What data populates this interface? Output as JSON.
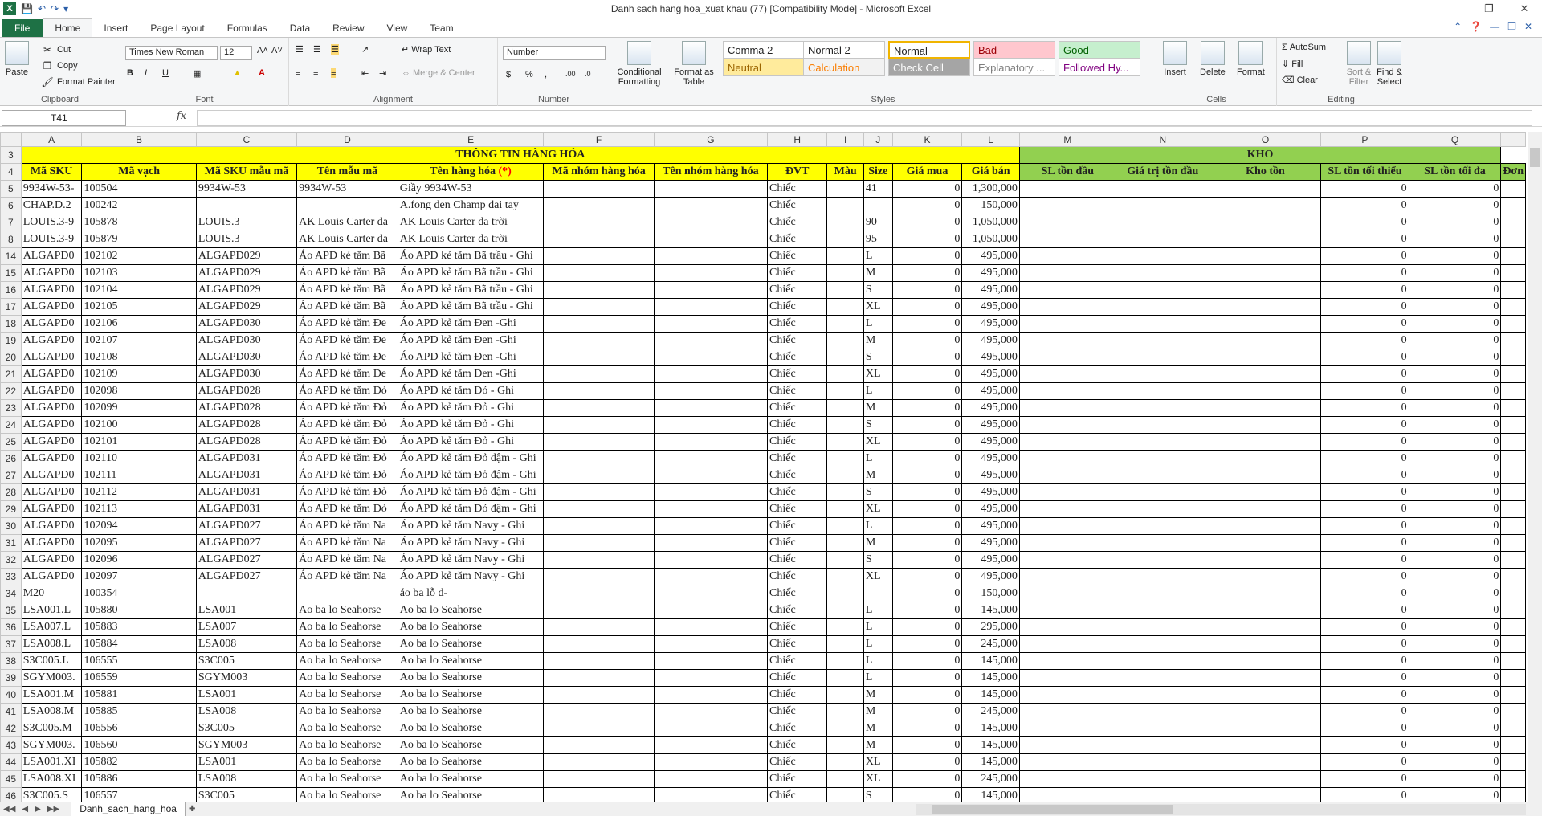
{
  "window": {
    "title": "Danh sach hang hoa_xuat khau (77)  [Compatibility Mode]  -  Microsoft Excel"
  },
  "tabs": [
    "File",
    "Home",
    "Insert",
    "Page Layout",
    "Formulas",
    "Data",
    "Review",
    "View",
    "Team"
  ],
  "ribbon": {
    "clipboard": {
      "label": "Clipboard",
      "paste": "Paste",
      "cut": "Cut",
      "copy": "Copy",
      "format_painter": "Format Painter"
    },
    "font": {
      "label": "Font",
      "name": "Times New Roman",
      "size": "12"
    },
    "alignment": {
      "label": "Alignment",
      "wrap": "Wrap Text",
      "merge": "Merge & Center"
    },
    "number": {
      "label": "Number",
      "format": "Number"
    },
    "styles": {
      "label": "Styles",
      "conditional": "Conditional Formatting",
      "format_table": "Format as Table",
      "cells": [
        {
          "name": "Comma 2",
          "bg": "#ffffff",
          "fg": "#222222"
        },
        {
          "name": "Normal 2",
          "bg": "#ffffff",
          "fg": "#222222"
        },
        {
          "name": "Normal",
          "bg": "#ffffff",
          "fg": "#222222"
        },
        {
          "name": "Bad",
          "bg": "#ffc7ce",
          "fg": "#9c0006"
        },
        {
          "name": "Good",
          "bg": "#c6efce",
          "fg": "#006100"
        },
        {
          "name": "Neutral",
          "bg": "#ffeb9c",
          "fg": "#9c6500"
        },
        {
          "name": "Calculation",
          "bg": "#f2f2f2",
          "fg": "#fa7d00"
        },
        {
          "name": "Check Cell",
          "bg": "#a5a5a5",
          "fg": "#ffffff"
        },
        {
          "name": "Explanatory ...",
          "bg": "#ffffff",
          "fg": "#7f7f7f"
        },
        {
          "name": "Followed Hy...",
          "bg": "#ffffff",
          "fg": "#800080"
        }
      ]
    },
    "cells": {
      "label": "Cells",
      "insert": "Insert",
      "delete": "Delete",
      "format": "Format"
    },
    "editing": {
      "label": "Editing",
      "autosum": "AutoSum",
      "fill": "Fill",
      "clear": "Clear",
      "sort": "Sort & Filter",
      "find": "Find & Select"
    }
  },
  "formula_bar": {
    "name_box": "T41",
    "fx": "fx",
    "formula": ""
  },
  "sheet": {
    "columns": [
      "A",
      "B",
      "C",
      "D",
      "E",
      "F",
      "G",
      "H",
      "I",
      "J",
      "K",
      "L",
      "M",
      "N",
      "O",
      "P",
      "Q"
    ],
    "row3": {
      "num": "3",
      "info": "THÔNG TIN HÀNG HÓA",
      "kho": "KHO"
    },
    "headers": [
      "Mã SKU",
      "Mã vạch",
      "Mã SKU mẫu mã",
      "Tên mẫu mã",
      "Tên hàng hóa ",
      "Mã nhóm hàng hóa",
      "Tên nhóm hàng hóa",
      "ĐVT",
      "Màu",
      "Size",
      "Giá mua",
      "Giá bán",
      "SL tồn đầu",
      "Giá trị tồn đầu",
      "Kho tồn",
      "SL tồn tối thiểu",
      "SL tồn tối đa"
    ],
    "header_required": "(*)",
    "next_col_clip": "Đơn",
    "rows": [
      [
        "5",
        "9934W-53-",
        "100504",
        "9934W-53",
        "9934W-53",
        "Giầy 9934W-53",
        "",
        "",
        "Chiếc",
        "",
        "41",
        "0",
        "1,300,000",
        "",
        "",
        "",
        "0",
        "0"
      ],
      [
        "6",
        "CHAP.D.2",
        "100242",
        "",
        "",
        "A.fong den Champ dai tay",
        "",
        "",
        "Chiếc",
        "",
        "",
        "0",
        "150,000",
        "",
        "",
        "",
        "0",
        "0"
      ],
      [
        "7",
        "LOUIS.3-9",
        "105878",
        "LOUIS.3",
        "AK Louis Carter da",
        "AK Louis Carter da trời",
        "",
        "",
        "Chiếc",
        "",
        "90",
        "0",
        "1,050,000",
        "",
        "",
        "",
        "0",
        "0"
      ],
      [
        "8",
        "LOUIS.3-9",
        "105879",
        "LOUIS.3",
        "AK Louis Carter da",
        "AK Louis Carter da trời",
        "",
        "",
        "Chiếc",
        "",
        "95",
        "0",
        "1,050,000",
        "",
        "",
        "",
        "0",
        "0"
      ],
      [
        "14",
        "ALGAPD0",
        "102102",
        "ALGAPD029",
        "Áo APD kẻ tăm Bã",
        "Áo APD kẻ tăm Bã trầu - Ghi",
        "",
        "",
        "Chiếc",
        "",
        "L",
        "0",
        "495,000",
        "",
        "",
        "",
        "0",
        "0"
      ],
      [
        "15",
        "ALGAPD0",
        "102103",
        "ALGAPD029",
        "Áo APD kẻ tăm Bã",
        "Áo APD kẻ tăm Bã trầu - Ghi",
        "",
        "",
        "Chiếc",
        "",
        "M",
        "0",
        "495,000",
        "",
        "",
        "",
        "0",
        "0"
      ],
      [
        "16",
        "ALGAPD0",
        "102104",
        "ALGAPD029",
        "Áo APD kẻ tăm Bã",
        "Áo APD kẻ tăm Bã trầu - Ghi",
        "",
        "",
        "Chiếc",
        "",
        "S",
        "0",
        "495,000",
        "",
        "",
        "",
        "0",
        "0"
      ],
      [
        "17",
        "ALGAPD0",
        "102105",
        "ALGAPD029",
        "Áo APD kẻ tăm Bã",
        "Áo APD kẻ tăm Bã trầu - Ghi",
        "",
        "",
        "Chiếc",
        "",
        "XL",
        "0",
        "495,000",
        "",
        "",
        "",
        "0",
        "0"
      ],
      [
        "18",
        "ALGAPD0",
        "102106",
        "ALGAPD030",
        "Áo APD kẻ tăm Đe",
        "Áo APD kẻ tăm Đen -Ghi",
        "",
        "",
        "Chiếc",
        "",
        "L",
        "0",
        "495,000",
        "",
        "",
        "",
        "0",
        "0"
      ],
      [
        "19",
        "ALGAPD0",
        "102107",
        "ALGAPD030",
        "Áo APD kẻ tăm Đe",
        "Áo APD kẻ tăm Đen -Ghi",
        "",
        "",
        "Chiếc",
        "",
        "M",
        "0",
        "495,000",
        "",
        "",
        "",
        "0",
        "0"
      ],
      [
        "20",
        "ALGAPD0",
        "102108",
        "ALGAPD030",
        "Áo APD kẻ tăm Đe",
        "Áo APD kẻ tăm Đen -Ghi",
        "",
        "",
        "Chiếc",
        "",
        "S",
        "0",
        "495,000",
        "",
        "",
        "",
        "0",
        "0"
      ],
      [
        "21",
        "ALGAPD0",
        "102109",
        "ALGAPD030",
        "Áo APD kẻ tăm Đe",
        "Áo APD kẻ tăm Đen -Ghi",
        "",
        "",
        "Chiếc",
        "",
        "XL",
        "0",
        "495,000",
        "",
        "",
        "",
        "0",
        "0"
      ],
      [
        "22",
        "ALGAPD0",
        "102098",
        "ALGAPD028",
        "Áo APD kẻ tăm Đỏ",
        "Áo APD kẻ tăm Đỏ - Ghi",
        "",
        "",
        "Chiếc",
        "",
        "L",
        "0",
        "495,000",
        "",
        "",
        "",
        "0",
        "0"
      ],
      [
        "23",
        "ALGAPD0",
        "102099",
        "ALGAPD028",
        "Áo APD kẻ tăm Đỏ",
        "Áo APD kẻ tăm Đỏ - Ghi",
        "",
        "",
        "Chiếc",
        "",
        "M",
        "0",
        "495,000",
        "",
        "",
        "",
        "0",
        "0"
      ],
      [
        "24",
        "ALGAPD0",
        "102100",
        "ALGAPD028",
        "Áo APD kẻ tăm Đỏ",
        "Áo APD kẻ tăm Đỏ - Ghi",
        "",
        "",
        "Chiếc",
        "",
        "S",
        "0",
        "495,000",
        "",
        "",
        "",
        "0",
        "0"
      ],
      [
        "25",
        "ALGAPD0",
        "102101",
        "ALGAPD028",
        "Áo APD kẻ tăm Đỏ",
        "Áo APD kẻ tăm Đỏ - Ghi",
        "",
        "",
        "Chiếc",
        "",
        "XL",
        "0",
        "495,000",
        "",
        "",
        "",
        "0",
        "0"
      ],
      [
        "26",
        "ALGAPD0",
        "102110",
        "ALGAPD031",
        "Áo APD kẻ tăm Đỏ",
        "Áo APD kẻ tăm Đỏ đậm - Ghi",
        "",
        "",
        "Chiếc",
        "",
        "L",
        "0",
        "495,000",
        "",
        "",
        "",
        "0",
        "0"
      ],
      [
        "27",
        "ALGAPD0",
        "102111",
        "ALGAPD031",
        "Áo APD kẻ tăm Đỏ",
        "Áo APD kẻ tăm Đỏ đậm - Ghi",
        "",
        "",
        "Chiếc",
        "",
        "M",
        "0",
        "495,000",
        "",
        "",
        "",
        "0",
        "0"
      ],
      [
        "28",
        "ALGAPD0",
        "102112",
        "ALGAPD031",
        "Áo APD kẻ tăm Đỏ",
        "Áo APD kẻ tăm Đỏ đậm - Ghi",
        "",
        "",
        "Chiếc",
        "",
        "S",
        "0",
        "495,000",
        "",
        "",
        "",
        "0",
        "0"
      ],
      [
        "29",
        "ALGAPD0",
        "102113",
        "ALGAPD031",
        "Áo APD kẻ tăm Đỏ",
        "Áo APD kẻ tăm Đỏ đậm - Ghi",
        "",
        "",
        "Chiếc",
        "",
        "XL",
        "0",
        "495,000",
        "",
        "",
        "",
        "0",
        "0"
      ],
      [
        "30",
        "ALGAPD0",
        "102094",
        "ALGAPD027",
        "Áo APD kẻ tăm Na",
        "Áo APD kẻ tăm Navy - Ghi",
        "",
        "",
        "Chiếc",
        "",
        "L",
        "0",
        "495,000",
        "",
        "",
        "",
        "0",
        "0"
      ],
      [
        "31",
        "ALGAPD0",
        "102095",
        "ALGAPD027",
        "Áo APD kẻ tăm Na",
        "Áo APD kẻ tăm Navy - Ghi",
        "",
        "",
        "Chiếc",
        "",
        "M",
        "0",
        "495,000",
        "",
        "",
        "",
        "0",
        "0"
      ],
      [
        "32",
        "ALGAPD0",
        "102096",
        "ALGAPD027",
        "Áo APD kẻ tăm Na",
        "Áo APD kẻ tăm Navy - Ghi",
        "",
        "",
        "Chiếc",
        "",
        "S",
        "0",
        "495,000",
        "",
        "",
        "",
        "0",
        "0"
      ],
      [
        "33",
        "ALGAPD0",
        "102097",
        "ALGAPD027",
        "Áo APD kẻ tăm Na",
        "Áo APD kẻ tăm Navy - Ghi",
        "",
        "",
        "Chiếc",
        "",
        "XL",
        "0",
        "495,000",
        "",
        "",
        "",
        "0",
        "0"
      ],
      [
        "34",
        "M20",
        "100354",
        "",
        "",
        "áo ba lỗ d-",
        "",
        "",
        "Chiếc",
        "",
        "",
        "0",
        "150,000",
        "",
        "",
        "",
        "0",
        "0"
      ],
      [
        "35",
        "LSA001.L",
        "105880",
        "LSA001",
        "Ao ba lo Seahorse",
        "Ao ba lo Seahorse",
        "",
        "",
        "Chiếc",
        "",
        "L",
        "0",
        "145,000",
        "",
        "",
        "",
        "0",
        "0"
      ],
      [
        "36",
        "LSA007.L",
        "105883",
        "LSA007",
        "Ao ba lo Seahorse",
        "Ao ba lo Seahorse",
        "",
        "",
        "Chiếc",
        "",
        "L",
        "0",
        "295,000",
        "",
        "",
        "",
        "0",
        "0"
      ],
      [
        "37",
        "LSA008.L",
        "105884",
        "LSA008",
        "Ao ba lo Seahorse",
        "Ao ba lo Seahorse",
        "",
        "",
        "Chiếc",
        "",
        "L",
        "0",
        "245,000",
        "",
        "",
        "",
        "0",
        "0"
      ],
      [
        "38",
        "S3C005.L",
        "106555",
        "S3C005",
        "Ao ba lo Seahorse",
        "Ao ba lo Seahorse",
        "",
        "",
        "Chiếc",
        "",
        "L",
        "0",
        "145,000",
        "",
        "",
        "",
        "0",
        "0"
      ],
      [
        "39",
        "SGYM003.",
        "106559",
        "SGYM003",
        "Ao ba lo Seahorse",
        "Ao ba lo Seahorse",
        "",
        "",
        "Chiếc",
        "",
        "L",
        "0",
        "145,000",
        "",
        "",
        "",
        "0",
        "0"
      ],
      [
        "40",
        "LSA001.M",
        "105881",
        "LSA001",
        "Ao ba lo Seahorse",
        "Ao ba lo Seahorse",
        "",
        "",
        "Chiếc",
        "",
        "M",
        "0",
        "145,000",
        "",
        "",
        "",
        "0",
        "0"
      ],
      [
        "41",
        "LSA008.M",
        "105885",
        "LSA008",
        "Ao ba lo Seahorse",
        "Ao ba lo Seahorse",
        "",
        "",
        "Chiếc",
        "",
        "M",
        "0",
        "245,000",
        "",
        "",
        "",
        "0",
        "0"
      ],
      [
        "42",
        "S3C005.M",
        "106556",
        "S3C005",
        "Ao ba lo Seahorse",
        "Ao ba lo Seahorse",
        "",
        "",
        "Chiếc",
        "",
        "M",
        "0",
        "145,000",
        "",
        "",
        "",
        "0",
        "0"
      ],
      [
        "43",
        "SGYM003.",
        "106560",
        "SGYM003",
        "Ao ba lo Seahorse",
        "Ao ba lo Seahorse",
        "",
        "",
        "Chiếc",
        "",
        "M",
        "0",
        "145,000",
        "",
        "",
        "",
        "0",
        "0"
      ],
      [
        "44",
        "LSA001.XI",
        "105882",
        "LSA001",
        "Ao ba lo Seahorse",
        "Ao ba lo Seahorse",
        "",
        "",
        "Chiếc",
        "",
        "XL",
        "0",
        "145,000",
        "",
        "",
        "",
        "0",
        "0"
      ],
      [
        "45",
        "LSA008.XI",
        "105886",
        "LSA008",
        "Ao ba lo Seahorse",
        "Ao ba lo Seahorse",
        "",
        "",
        "Chiếc",
        "",
        "XL",
        "0",
        "245,000",
        "",
        "",
        "",
        "0",
        "0"
      ],
      [
        "46",
        "S3C005.S",
        "106557",
        "S3C005",
        "Ao ba lo Seahorse",
        "Ao ba lo Seahorse",
        "",
        "",
        "Chiếc",
        "",
        "S",
        "0",
        "145,000",
        "",
        "",
        "",
        "0",
        "0"
      ]
    ],
    "tab_name": "Danh_sach_hang_hoa"
  }
}
